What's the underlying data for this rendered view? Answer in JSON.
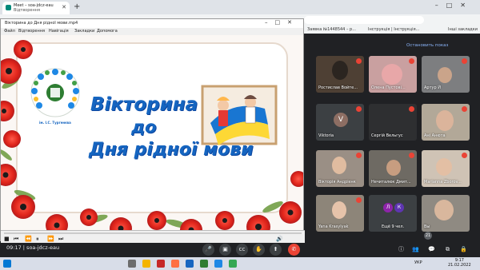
{
  "browser": {
    "tab_title": "Meet – soa-jdcz-eau",
    "tab_subtitle": "Відтворення",
    "new_tab_icon": "plus-icon",
    "bookmarks": [
      "Заявка №1448544 – р...",
      "Інструкція | Інструкція...",
      "Інші закладки"
    ]
  },
  "player": {
    "title": "Вікторина до Дня рідної мови.mp4",
    "menu": [
      "Файл",
      "Відтворення",
      "Навігація",
      "Закладки",
      "Допомога"
    ],
    "window_controls": [
      "–",
      "□",
      "✕"
    ],
    "controls": [
      "■",
      "⏮",
      "⏪",
      "⏸",
      "⏩",
      "⏭",
      "🔊"
    ]
  },
  "slide": {
    "title_line1": "Вікторина",
    "title_line2": "до",
    "title_line3": "Дня рідної мови",
    "logo_caption": "ім. І.С. Тургенєва"
  },
  "meet": {
    "show_button": "Остановить показ",
    "participants": [
      {
        "name": "Ростислав Войте...",
        "muted": true
      },
      {
        "name": "Олена Пустові...",
        "muted": true
      },
      {
        "name": "Артур Й",
        "muted": true
      },
      {
        "name": "Viktoria",
        "muted": true,
        "initial": "V"
      },
      {
        "name": "Сергій Вельгус",
        "muted": true
      },
      {
        "name": "Ані Анюта",
        "muted": true
      },
      {
        "name": "Вікторія Андрієнк",
        "muted": true
      },
      {
        "name": "Нечиталюк Дмит...",
        "muted": true
      },
      {
        "name": "Marianna Zborov...",
        "muted": true
      },
      {
        "name": "Yana Krasylyak",
        "muted": true
      },
      {
        "name": "Ещё 9 чел.",
        "muted": false
      },
      {
        "name": "Вы",
        "muted": false
      }
    ],
    "others_initials": [
      "Л",
      "К"
    ],
    "participant_count": "21",
    "time_code": "09:17 | soa-jdcz-eau"
  },
  "taskbar": {
    "lang": "УКР",
    "time": "9:17",
    "date": "21.02.2022"
  },
  "colors": {
    "meet_bg": "#202124",
    "tile_bg": "#3c4043",
    "slide_title": "#1565c0",
    "poppy_red": "#e53935",
    "hangup_red": "#ea4335"
  }
}
